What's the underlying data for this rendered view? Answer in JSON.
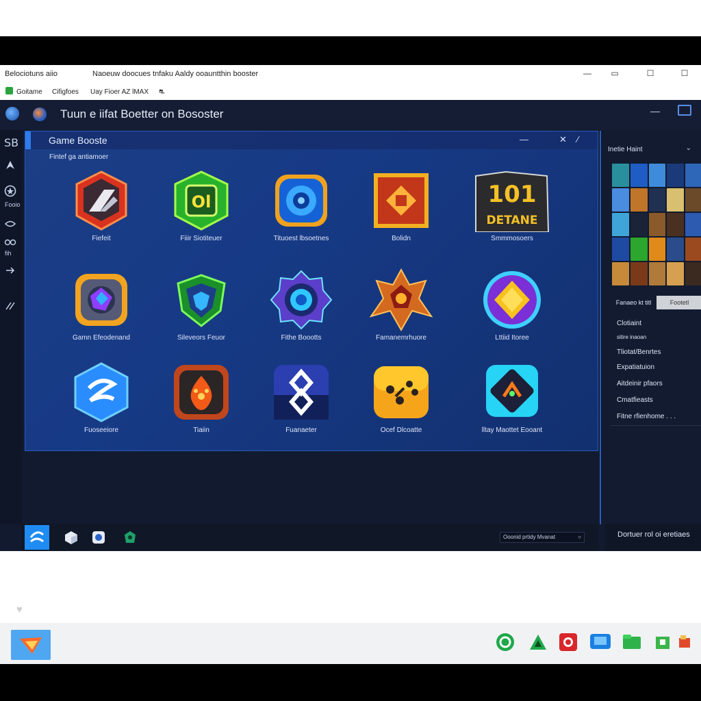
{
  "window": {
    "app_name": "Belociotuns aiio",
    "title": "Naoeuw doocues tnfaku Aaldy ooauntthin booster",
    "minimize": "—",
    "restore": "▭",
    "maximize": "☐",
    "close": "☐"
  },
  "menu": {
    "items": [
      "Goitame",
      "Cifigfoes",
      "Uay Fioer AZ lMAX",
      "⛐"
    ]
  },
  "app": {
    "title": "Tuun e iifat Boetter on Bososter",
    "collapse_label": "—"
  },
  "rail": {
    "labels": [
      "Fooio",
      "fih"
    ]
  },
  "panel": {
    "title": "Game Booste",
    "subtitle": "Fintef ga antiamoer",
    "min": "—",
    "close": "✕",
    "up": "∕",
    "tiles": [
      {
        "label": "Fiefeit"
      },
      {
        "label": "Fiiir Siotiteuer"
      },
      {
        "label": "Tituoest lbsoetnes"
      },
      {
        "label": "Bolidn"
      },
      {
        "label": "Smmmosoers",
        "badge_top": "101",
        "badge_bottom": "DETANE"
      },
      {
        "label": "Gamn Efeodenand"
      },
      {
        "label": "Sileveors Feuor"
      },
      {
        "label": "Fithe Boootts"
      },
      {
        "label": "Famanemrhuore"
      },
      {
        "label": "Lttiid Itoree"
      },
      {
        "label": "Fuoseeiore"
      },
      {
        "label": "Tiaiin"
      },
      {
        "label": "Fuanaeter"
      },
      {
        "label": "Ocef Dlcoatte"
      },
      {
        "label": "lltay Maottet Eooant"
      }
    ]
  },
  "right_panel": {
    "header": "Inetie Haint",
    "tabs": [
      "Fanaeo kt titl",
      "Footetl"
    ],
    "list": [
      "Clotiaint",
      "sitire inaoan",
      "Tliotat/Benrtes",
      "Expatiatuion",
      "Aitdeinir pfaors",
      "Cmatfieasts",
      "Fitne rfienhome . . ."
    ]
  },
  "bottom": {
    "status_text": "Ooonid prtidy Mvanat",
    "status_dot": "○",
    "right_text": "Dortuer rol oi eretiaes"
  },
  "colors": {
    "accent": "#2d8cf0",
    "panel_bg": "#173a86",
    "app_bg": "#111a2e"
  }
}
